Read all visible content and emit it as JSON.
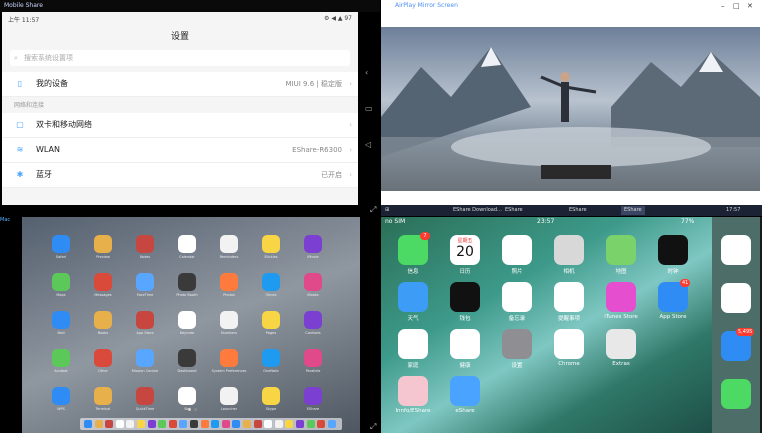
{
  "top_left": {
    "window_title": "Mobile Share",
    "status_time": "上午 11:57",
    "status_right": "⚙ ◀ ▲ 97",
    "title": "设置",
    "search_placeholder": "搜索系统设置项",
    "rows": [
      {
        "label": "我的设备",
        "value": "MIUI 9.6 | 稳定版",
        "icon": "phone-icon"
      },
      {
        "label": "双卡和移动网络",
        "value": "",
        "icon": "sim-icon"
      },
      {
        "label": "WLAN",
        "value": "EShare-R6300",
        "icon": "wifi-icon"
      },
      {
        "label": "蓝牙",
        "value": "已开启",
        "icon": "bluetooth-icon"
      }
    ],
    "section_label": "网络和连接"
  },
  "top_right": {
    "window_title": "AirPlay Mirror Screen",
    "taskbar_items": [
      "EShare Download…",
      "EShare",
      "EShare",
      "EShare"
    ],
    "clock": "17:57"
  },
  "bottom_left": {
    "window_title": "Mac",
    "apps": [
      [
        "Safari",
        "Preview",
        "Notes",
        "Calendar",
        "Reminders",
        "Stickies",
        "iMovie"
      ],
      [
        "Maps",
        "Messages",
        "FaceTime",
        "Photo Booth",
        "Photos",
        "iTunes",
        "iBooks"
      ],
      [
        "Mail",
        "Books",
        "App Store",
        "Keynote",
        "Numbers",
        "Pages",
        "Contacts"
      ],
      [
        "Acrobat",
        "Other",
        "Mission Control",
        "Dashboard",
        "System Preferences",
        "OneNote",
        "Parallels"
      ],
      [
        "WPS",
        "Terminal",
        "QuickTime",
        "Siri",
        "Launcher",
        "Skype",
        "EShare"
      ]
    ]
  },
  "bottom_right": {
    "status_left": "no SIM",
    "status_time": "23:57",
    "status_right": "77%",
    "date_day": "20",
    "date_weekday": "星期五",
    "apps": [
      [
        {
          "n": "信息",
          "c": "#4cd964",
          "badge": "7"
        },
        {
          "n": "日历",
          "c": "#ffffff"
        },
        {
          "n": "照片",
          "c": "#ffffff"
        },
        {
          "n": "相机",
          "c": "#d8d8d8"
        },
        {
          "n": "地图",
          "c": "#7ad36a"
        },
        {
          "n": "时钟",
          "c": "#111111"
        }
      ],
      [
        {
          "n": "天气",
          "c": "#3d9cf5"
        },
        {
          "n": "钱包",
          "c": "#111111"
        },
        {
          "n": "备忘录",
          "c": "#ffffff"
        },
        {
          "n": "提醒事项",
          "c": "#ffffff"
        },
        {
          "n": "iTunes Store",
          "c": "#e44ecf"
        },
        {
          "n": "App Store",
          "c": "#2f8cf5",
          "badge": "41"
        }
      ],
      [
        {
          "n": "家庭",
          "c": "#ffffff"
        },
        {
          "n": "健康",
          "c": "#ffffff"
        },
        {
          "n": "设置",
          "c": "#8e8e93"
        },
        {
          "n": "Chrome",
          "c": "#ffffff"
        },
        {
          "n": "Extras",
          "c": "#e8e8e8"
        }
      ],
      [
        {
          "n": "Innfo/EShare",
          "c": "#f5c6d0"
        },
        {
          "n": "eShare",
          "c": "#4aa3ff"
        }
      ]
    ],
    "dock_apps": [
      {
        "n": "Music",
        "c": "#ffffff"
      },
      {
        "n": "Safari",
        "c": "#ffffff"
      },
      {
        "n": "Mail",
        "c": "#2f8cf5",
        "badge": "5,495"
      },
      {
        "n": "Phone",
        "c": "#4cd964"
      }
    ]
  }
}
